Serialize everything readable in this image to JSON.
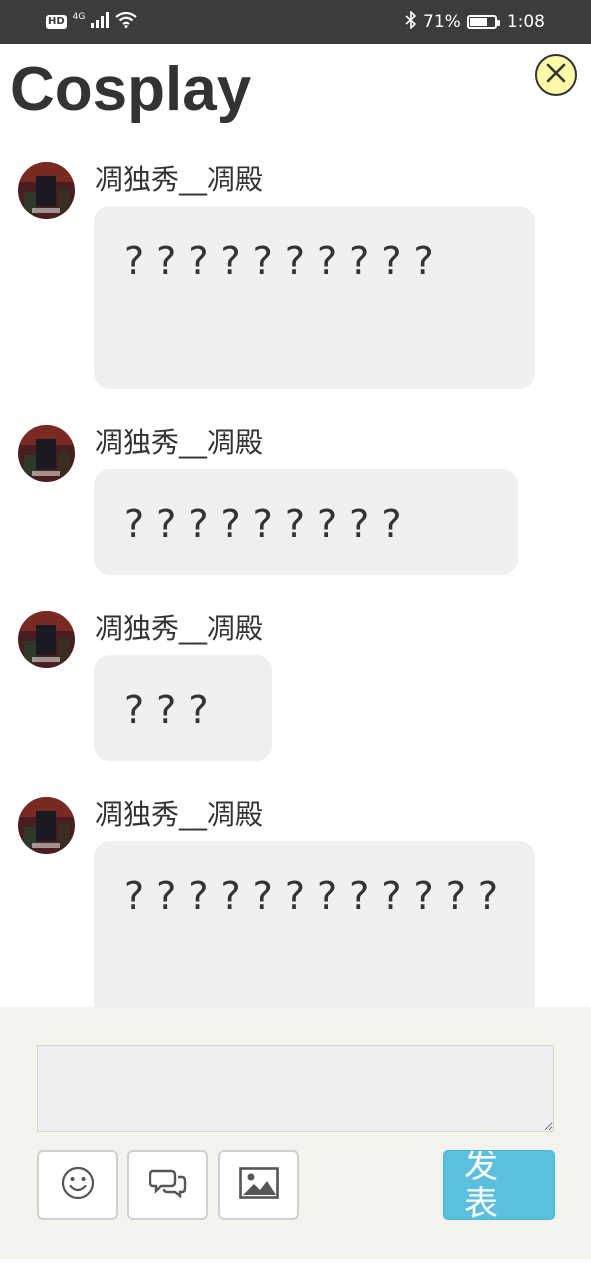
{
  "status_bar": {
    "hd": "HD",
    "network": "4G",
    "battery_percent": "71%",
    "battery_level": 0.71,
    "time": "1:08",
    "icons": [
      "signal-icon",
      "wifi-icon",
      "bluetooth-icon",
      "battery-icon"
    ]
  },
  "header": {
    "title": "Cosplay",
    "close_icon": "close-icon",
    "close_color": "#fff9a8"
  },
  "messages": [
    {
      "username": "凋独秀__凋殿",
      "text": "??????????"
    },
    {
      "username": "凋独秀__凋殿",
      "text": "?????????"
    },
    {
      "username": "凋独秀__凋殿",
      "text": "???"
    },
    {
      "username": "凋独秀__凋殿",
      "text": "????????????"
    }
  ],
  "composer": {
    "input_value": "",
    "tools": [
      "smiley-icon",
      "chat-bubbles-icon",
      "image-icon"
    ],
    "send_label": "发表",
    "send_color": "#5bc0de"
  }
}
